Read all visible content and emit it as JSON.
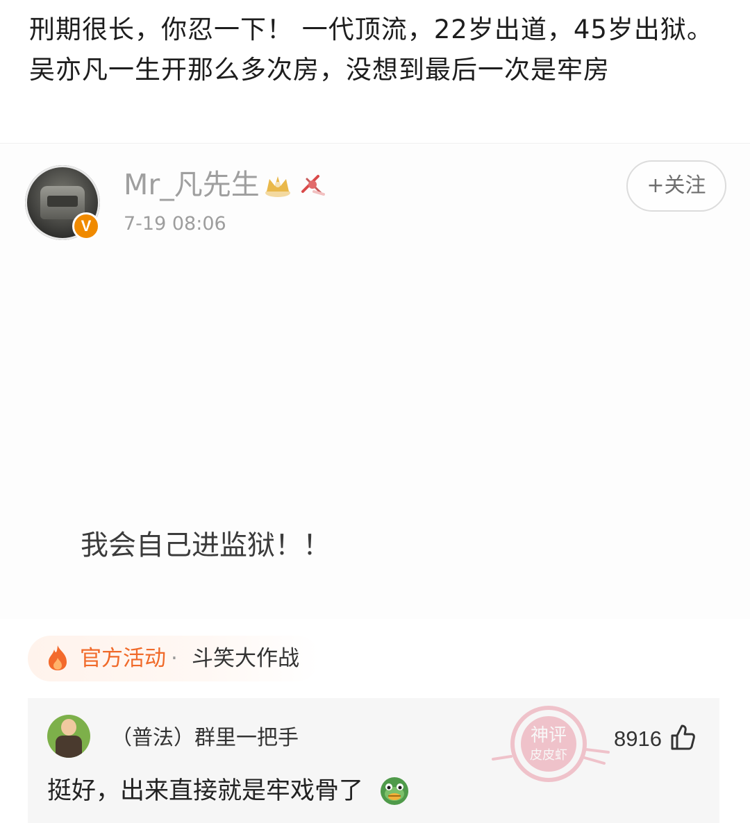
{
  "caption": "刑期很长，你忍一下！ 一代顶流，22岁出道，45岁出狱。 吴亦凡一生开那么多次房，没想到最后一次是牢房",
  "post": {
    "username": "Mr_凡先生",
    "timestamp": "7-19 08:06",
    "follow_label": "+关注",
    "verified_badge": "V",
    "text": "我会自己进监狱！！",
    "icons": [
      "crown-icon",
      "fan-club-icon"
    ]
  },
  "activity": {
    "label": "官方活动",
    "separator": "·",
    "name": "斗笑大作战",
    "icon": "fire-icon"
  },
  "comment": {
    "username": "（普法）群里一把手",
    "likes": "8916",
    "text": "挺好，出来直接就是牢戏骨了",
    "emoji": "turtle-icon",
    "watermark": [
      "神评",
      "皮皮虾"
    ]
  },
  "colors": {
    "accent_orange": "#f06a2a",
    "verified_orange": "#f08a00"
  }
}
